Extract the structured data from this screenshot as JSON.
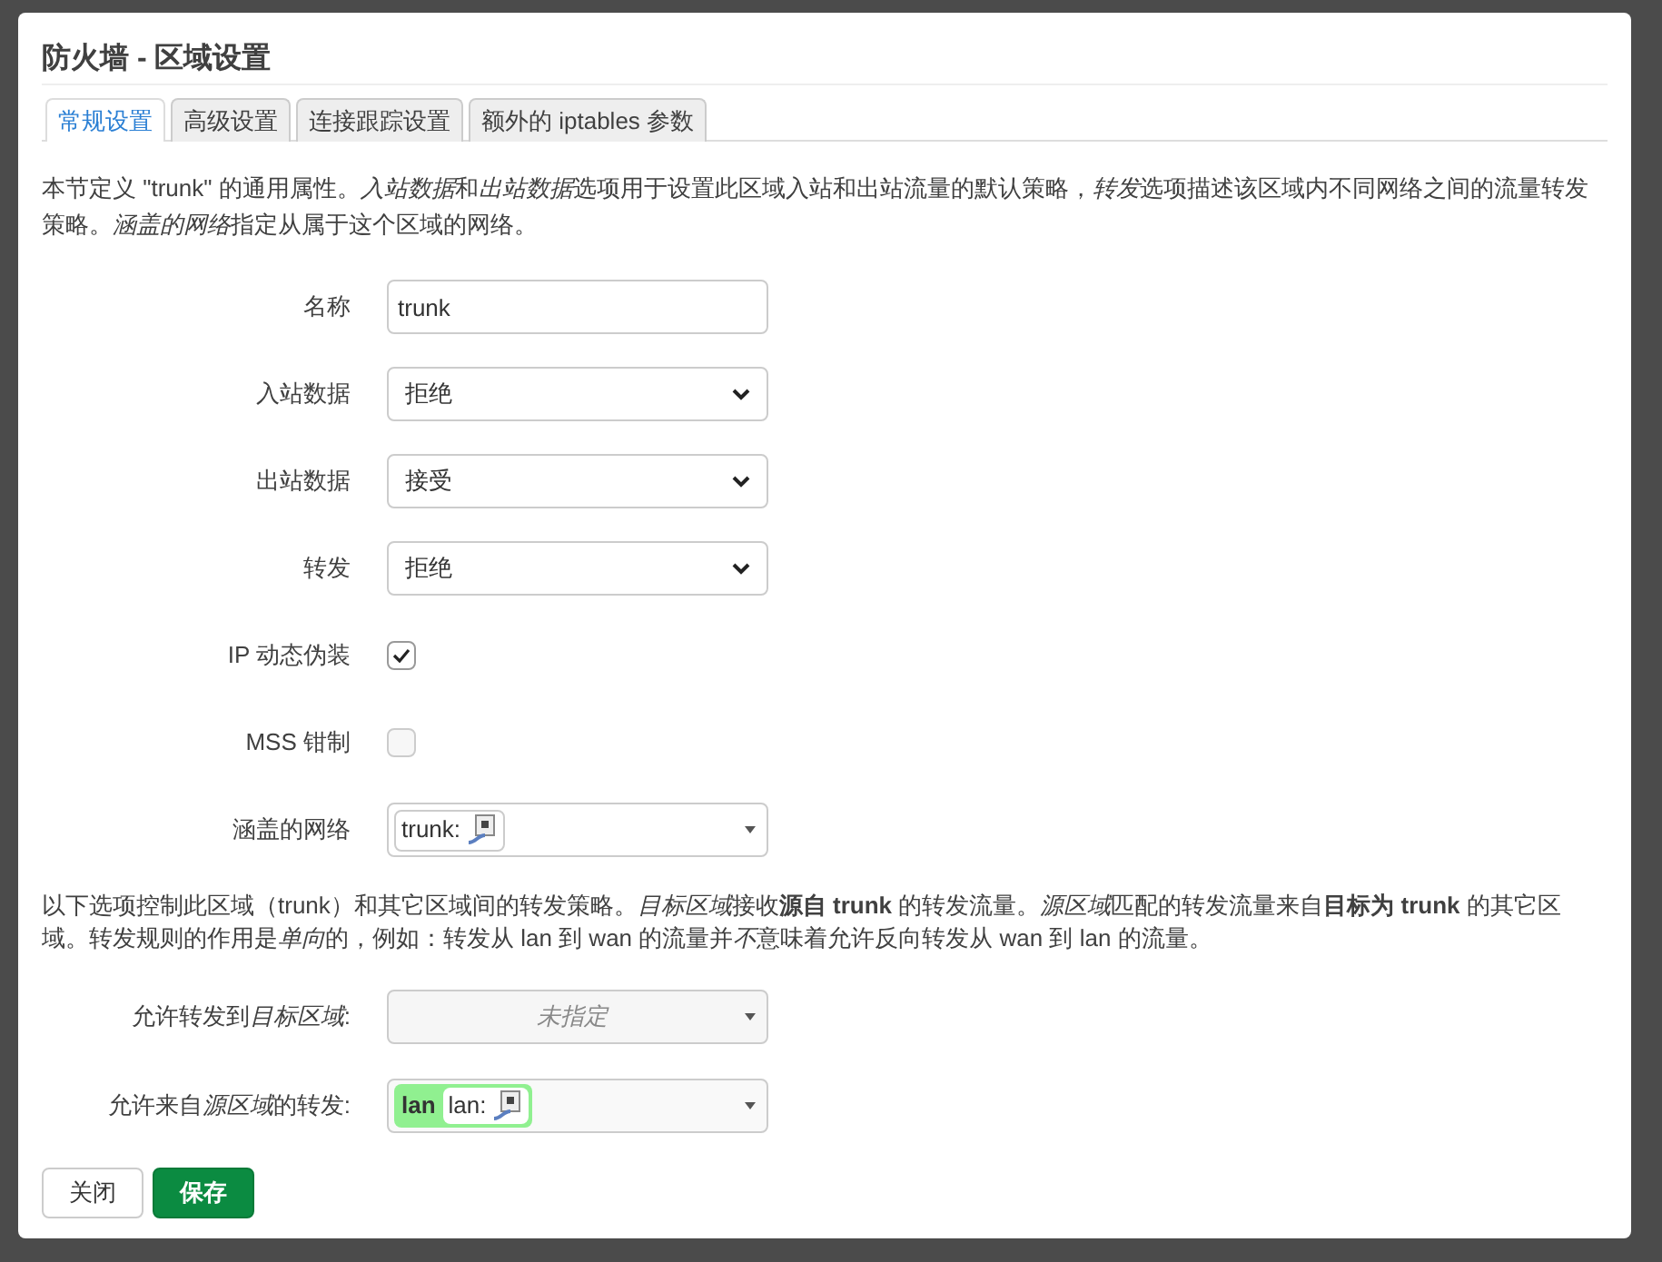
{
  "dialog": {
    "title": "防火墙 - 区域设置"
  },
  "tabs": [
    {
      "label": "常规设置",
      "selected": true
    },
    {
      "label": "高级设置",
      "selected": false
    },
    {
      "label": "连接跟踪设置",
      "selected": false
    },
    {
      "label": "额外的 iptables 参数",
      "selected": false
    }
  ],
  "intro": [
    {
      "kind": "plain",
      "text": "本节定义 \"trunk\" 的通用属性。"
    },
    {
      "kind": "italic",
      "text": "入站数据"
    },
    {
      "kind": "plain",
      "text": "和"
    },
    {
      "kind": "italic",
      "text": "出站数据"
    },
    {
      "kind": "plain",
      "text": "选项用于设置此区域入站和出站流量的默认策略，"
    },
    {
      "kind": "italic",
      "text": "转发"
    },
    {
      "kind": "plain",
      "text": "选项描述该区域内不同网络之间的流量转发策略。"
    },
    {
      "kind": "italic",
      "text": "涵盖的网络"
    },
    {
      "kind": "plain",
      "text": "指定从属于这个区域的网络。"
    }
  ],
  "fields": [
    {
      "kind": "text",
      "label": "名称",
      "value": "trunk"
    },
    {
      "kind": "select",
      "label": "入站数据",
      "value": "拒绝"
    },
    {
      "kind": "select",
      "label": "出站数据",
      "value": "接受"
    },
    {
      "kind": "select",
      "label": "转发",
      "value": "拒绝"
    },
    {
      "kind": "checkbox",
      "label": "IP 动态伪装",
      "checked": true
    },
    {
      "kind": "checkbox",
      "label": "MSS 钳制",
      "checked": false
    },
    {
      "kind": "networks",
      "label": "涵盖的网络",
      "chips": [
        {
          "label": "trunk:"
        }
      ]
    }
  ],
  "forward_intro": [
    {
      "kind": "plain",
      "text": "以下选项控制此区域（trunk）和其它区域间的转发策略。"
    },
    {
      "kind": "italic",
      "text": "目标区域"
    },
    {
      "kind": "plain",
      "text": "接收"
    },
    {
      "kind": "bold",
      "text": "源自 trunk"
    },
    {
      "kind": "plain",
      "text": " 的转发流量。"
    },
    {
      "kind": "italic",
      "text": "源区域"
    },
    {
      "kind": "plain",
      "text": "匹配的转发流量来自"
    },
    {
      "kind": "bold",
      "text": "目标为 trunk"
    },
    {
      "kind": "plain",
      "text": " 的其它区域。转发规则的作用是"
    },
    {
      "kind": "italic",
      "text": "单向"
    },
    {
      "kind": "plain",
      "text": "的，例如：转发从 lan 到 wan 的流量并"
    },
    {
      "kind": "italic",
      "text": "不"
    },
    {
      "kind": "plain",
      "text": "意味着允许反向转发从 wan 到 lan 的流量。"
    }
  ],
  "forward_fields": [
    {
      "label": [
        {
          "kind": "plain",
          "text": "允许转发到"
        },
        {
          "kind": "italic",
          "text": "目标区域"
        },
        {
          "kind": "plain",
          "text": ":"
        }
      ],
      "placeholder": "未指定"
    },
    {
      "label": [
        {
          "kind": "plain",
          "text": "允许来自"
        },
        {
          "kind": "italic",
          "text": "源区域"
        },
        {
          "kind": "plain",
          "text": "的转发:"
        }
      ],
      "zones": [
        {
          "name": "lan",
          "color": "#90f090",
          "chip": "lan:"
        }
      ]
    }
  ],
  "buttons": [
    {
      "label": "关闭",
      "kind": "secondary"
    },
    {
      "label": "保存",
      "kind": "primary"
    }
  ]
}
